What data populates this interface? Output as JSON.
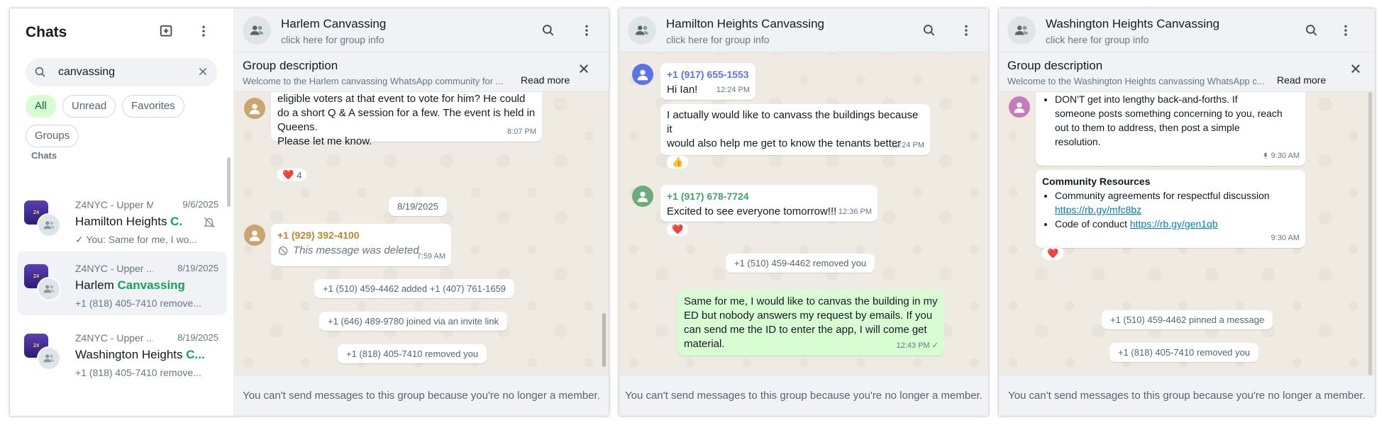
{
  "colors": {
    "accent_green": "#15a35a",
    "chat_bg": "#efeae2",
    "outgoing_bubble": "#d9fdd3",
    "header_bg": "#f0f2f5"
  },
  "sidebar": {
    "title": "Chats",
    "search": {
      "value": "canvassing",
      "icon": "search-icon"
    },
    "filters": [
      "All",
      "Unread",
      "Favorites",
      "Groups"
    ],
    "active_filter": "All",
    "section_label": "Chats",
    "chats": [
      {
        "community": "Z4NYC - Upper M...",
        "date": "9/6/2025",
        "name_prefix": "Hamilton Heights ",
        "name_highlight": "C...",
        "preview": "✓ You: Same for me, I wo...",
        "muted": true
      },
      {
        "community": "Z4NYC - Upper ...",
        "date": "8/19/2025",
        "name_prefix": "Harlem ",
        "name_highlight": "Canvassing",
        "preview": "+1 (818) 405-7410 remove...",
        "selected": true
      },
      {
        "community": "Z4NYC - Upper ...",
        "date": "8/19/2025",
        "name_prefix": "Washington Heights ",
        "name_highlight": "C...",
        "preview": "+1 (818) 405-7410 remove..."
      }
    ]
  },
  "windows": [
    {
      "header": {
        "name": "Harlem Canvassing",
        "subtitle": "click here for group info"
      },
      "description": {
        "title": "Group description",
        "text": "Welcome to the Harlem canvassing WhatsApp community for ...",
        "read_more": "Read more"
      },
      "messages": {
        "m1": {
          "lines": [
            "eligible voters at that event to vote for him?  He could",
            "do a short Q & A session for a few.  The event is held in",
            "Queens.",
            "Please let me know."
          ],
          "time": "8:07 PM",
          "reaction": "❤️",
          "reaction_count": "4"
        },
        "date": "8/19/2025",
        "m2": {
          "sender": "+1 (929) 392-4100",
          "sender_color": "#b7882c",
          "deleted": "This message was deleted",
          "time": "7:59 AM"
        },
        "sys": [
          "+1 (510) 459-4462 added +1 (407) 761-1659",
          "+1 (646) 489-9780 joined via an invite link",
          "+1 (818) 405-7410 removed you"
        ]
      },
      "footer": "You can't send messages to this group because you're no longer a member."
    },
    {
      "header": {
        "name": "Hamilton Heights Canvassing",
        "subtitle": "click here for group info"
      },
      "messages": {
        "m1": {
          "sender": "+1 (917) 655-1553",
          "sender_color": "#5a73e8",
          "text": "Hi Ian!",
          "time": "12:24 PM"
        },
        "m2": {
          "lines": [
            "I actually would like to canvass the buildings because it",
            "would also help me get to know the tenants better"
          ],
          "time": "12:24 PM",
          "reaction": "👍"
        },
        "m3": {
          "sender": "+1 (917) 678-7724",
          "sender_color": "#3fa66a",
          "text": "Excited to see everyone tomorrow!!!",
          "time": "12:36 PM",
          "reaction": "❤️"
        },
        "sys": [
          "+1 (510) 459-4462 removed you"
        ],
        "out": {
          "lines": [
            "Same for me, I would like to canvas the building in my",
            "ED but nobody answers my request by emails. If you",
            "can send me the ID to enter the app, I will come get",
            "material."
          ],
          "time": "12:43 PM",
          "tick": "✓"
        }
      },
      "footer": "You can't send messages to this group because you're no longer a member."
    },
    {
      "header": {
        "name": "Washington Heights Canvassing",
        "subtitle": "click here for group info"
      },
      "description": {
        "title": "Group description",
        "text": "Welcome to the Washington Heights canvassing WhatsApp c...",
        "read_more": "Read more"
      },
      "messages": {
        "m1": {
          "lines": [
            "DON'T get into lengthy back-and-forths. If",
            "someone posts something concerning to you, reach",
            "out to them to address, then post a simple",
            "resolution."
          ],
          "time": "9:30 AM"
        },
        "m2": {
          "title": "Community Resources",
          "items": [
            {
              "text": "Community agreements for respectful discussion",
              "link": "https://rb.gy/mfc8bz"
            },
            {
              "text": "Code of conduct ",
              "link": "https://rb.gy/gen1qb"
            }
          ],
          "time": "9:30 AM",
          "reaction": "❤️"
        },
        "sys": [
          "+1 (510) 459-4462 pinned a message",
          "+1 (818) 405-7410 removed you"
        ]
      },
      "footer": "You can't send messages to this group because you're no longer a member."
    }
  ]
}
